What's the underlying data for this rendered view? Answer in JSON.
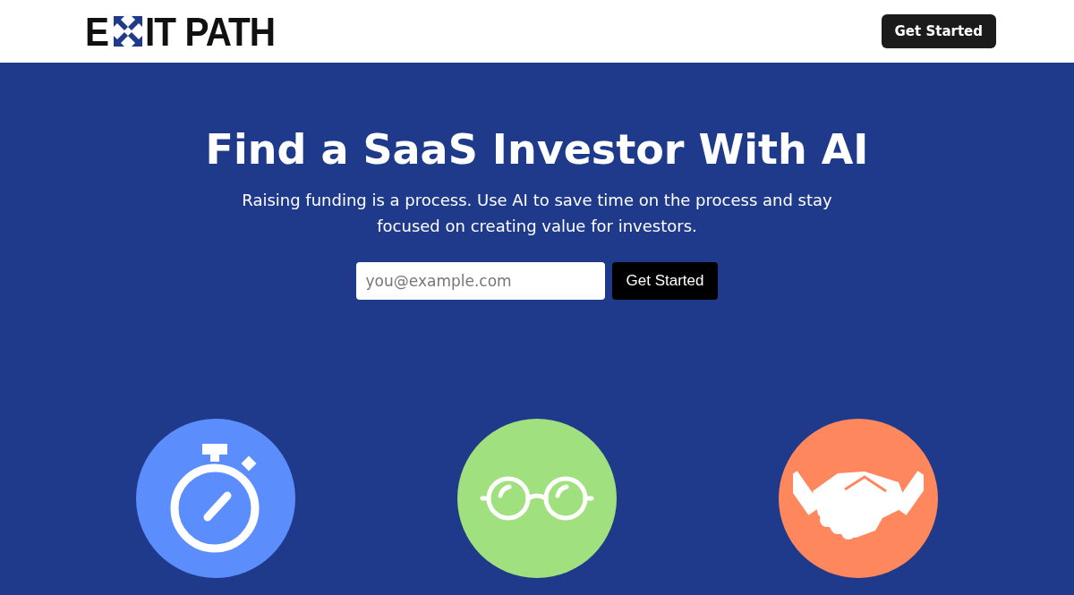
{
  "header": {
    "logo": {
      "before": "E",
      "after": "IT PATH"
    },
    "button": "Get Started"
  },
  "hero": {
    "title": "Find a SaaS Investor With AI",
    "subtitle": "Raising funding is a process. Use AI to save time on the process and stay focused on creating value for investors.",
    "email": {
      "placeholder": "you@example.com"
    },
    "button": "Get Started"
  },
  "features": [
    {
      "kind": "stopwatch",
      "color": "#5b8efc"
    },
    {
      "kind": "glasses",
      "color": "#a0e07e"
    },
    {
      "kind": "handshake",
      "color": "#ff875e"
    }
  ]
}
